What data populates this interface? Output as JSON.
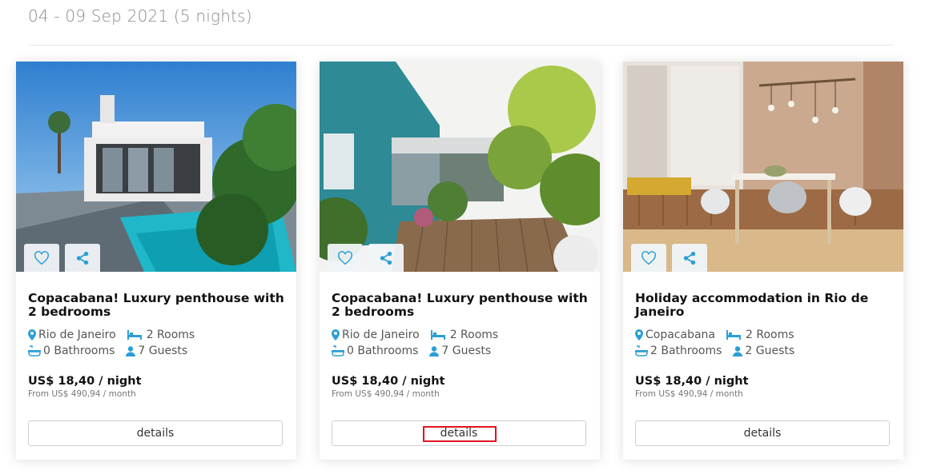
{
  "header": {
    "date_range": "04 - 09 Sep 2021 (5 nights)"
  },
  "colors": {
    "accent": "#2a9fd6",
    "highlight": "#e0141e"
  },
  "listings": [
    {
      "title": "Copacabana! Luxury penthouse with 2 bedrooms",
      "location": "Rio de Janeiro",
      "rooms": "2 Rooms",
      "bathrooms": "0 Bathrooms",
      "guests": "7 Guests",
      "price": "US$ 18,40 / night",
      "monthly": "From US$ 490,94 / month",
      "button_label": "details",
      "icons": [
        "heart-icon",
        "share-icon",
        "map-pin-icon",
        "bed-icon",
        "bathtub-icon",
        "user-icon"
      ]
    },
    {
      "title": "Copacabana! Luxury penthouse with 2 bedrooms",
      "location": "Rio de Janeiro",
      "rooms": "2 Rooms",
      "bathrooms": "0 Bathrooms",
      "guests": "7 Guests",
      "price": "US$ 18,40 / night",
      "monthly": "From US$ 490,94 / month",
      "button_label": "details",
      "icons": [
        "heart-icon",
        "share-icon",
        "map-pin-icon",
        "bed-icon",
        "bathtub-icon",
        "user-icon"
      ]
    },
    {
      "title": "Holiday accommodation in Rio de Janeiro",
      "location": "Copacabana",
      "rooms": "2 Rooms",
      "bathrooms": "2 Bathrooms",
      "guests": "2 Guests",
      "price": "US$ 18,40 / night",
      "monthly": "From US$ 490,94 / month",
      "button_label": "details",
      "icons": [
        "heart-icon",
        "share-icon",
        "map-pin-icon",
        "bed-icon",
        "bathtub-icon",
        "user-icon"
      ]
    }
  ]
}
